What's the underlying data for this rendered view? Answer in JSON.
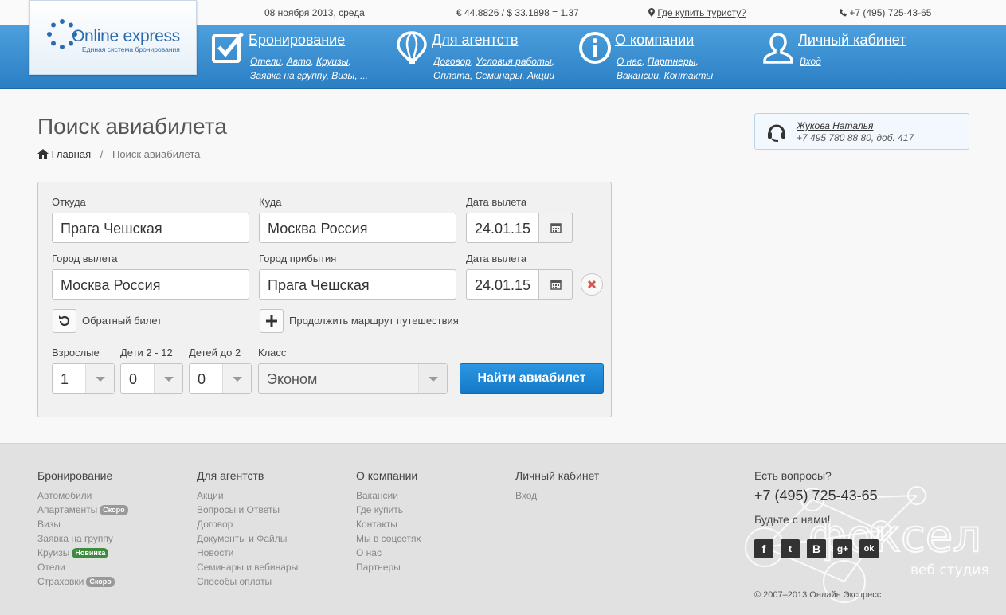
{
  "topbar": {
    "date": "08 ноября 2013, среда",
    "rates": "€ 44.8826 / $ 33.1898 = 1.37",
    "where_buy": "Где купить туристу?",
    "phone": "+7 (495) 725-43-65"
  },
  "logo": {
    "brand": "Online express",
    "tagline": "Единая система бронирования"
  },
  "nav": [
    {
      "title": "Бронирование",
      "lines": [
        [
          "Отели",
          "Авто",
          "Круизы"
        ],
        [
          "Заявка на группу",
          "Визы",
          "..."
        ]
      ]
    },
    {
      "title": "Для агентств",
      "lines": [
        [
          "Договор",
          "Условия работы"
        ],
        [
          "Оплата",
          "Семинары",
          "Акции"
        ]
      ]
    },
    {
      "title": "О компании",
      "lines": [
        [
          "О нас",
          "Партнеры"
        ],
        [
          "Вакансии",
          "Контакты"
        ]
      ]
    },
    {
      "title": "Личный кабинет",
      "lines": [
        [
          "Вход"
        ]
      ]
    }
  ],
  "page": {
    "title": "Поиск авиабилета",
    "breadcrumb_home": "Главная",
    "breadcrumb_sep": "/",
    "breadcrumb_current": "Поиск авиабилета"
  },
  "manager": {
    "name": "Жукова Наталья",
    "phone": "+7 495 780 88 80, доб. 417"
  },
  "form": {
    "row1": {
      "from_label": "Откуда",
      "from_value": "Прага Чешская",
      "to_label": "Куда",
      "to_value": "Москва Россия",
      "date_label": "Дата вылета",
      "date_value": "24.01.15"
    },
    "row2": {
      "from_label": "Город вылета",
      "from_value": "Москва Россия",
      "to_label": "Город прибытия",
      "to_value": "Прага Чешская",
      "date_label": "Дата вылета",
      "date_value": "24.01.15"
    },
    "return_ticket": "Обратный билет",
    "continue_route": "Продолжить маршрут путешествия",
    "adults_label": "Взрослые",
    "adults_value": "1",
    "children_label": "Дети 2 - 12",
    "children_value": "0",
    "infants_label": "Детей до 2",
    "infants_value": "0",
    "class_label": "Класс",
    "class_value": "Эконом",
    "submit": "Найти авиабилет"
  },
  "footer": {
    "cols": [
      {
        "title": "Бронирование",
        "items": [
          {
            "label": "Автомобили"
          },
          {
            "label": "Апартаменты",
            "badge": "Скоро"
          },
          {
            "label": "Визы"
          },
          {
            "label": "Заявка на группу"
          },
          {
            "label": "Круизы",
            "badge": "Новинка",
            "badge_color": "green"
          },
          {
            "label": "Отели"
          },
          {
            "label": "Страховки",
            "badge": "Скоро"
          }
        ]
      },
      {
        "title": "Для агентств",
        "items": [
          {
            "label": "Акции"
          },
          {
            "label": "Вопросы и Ответы"
          },
          {
            "label": "Договор"
          },
          {
            "label": "Документы и Файлы"
          },
          {
            "label": "Новости"
          },
          {
            "label": "Семинары и вебинары"
          },
          {
            "label": "Способы оплаты"
          }
        ]
      },
      {
        "title": "О компании",
        "items": [
          {
            "label": "Вакансии"
          },
          {
            "label": "Где купить"
          },
          {
            "label": "Контакты"
          },
          {
            "label": "Мы в соцсетях"
          },
          {
            "label": "О нас"
          },
          {
            "label": "Партнеры"
          }
        ]
      },
      {
        "title": "Личный кабинет",
        "items": [
          {
            "label": "Вход"
          }
        ]
      }
    ],
    "questions": "Есть вопросы?",
    "phone": "+7 (495) 725-43-65",
    "join": "Будьте с нами!",
    "socials": [
      "f",
      "t",
      "B",
      "g+",
      "ok"
    ],
    "copyright": "© 2007–2013 Онлайн Экспресс",
    "watermark": "фоксел",
    "watermark_sub": "веб студия"
  }
}
